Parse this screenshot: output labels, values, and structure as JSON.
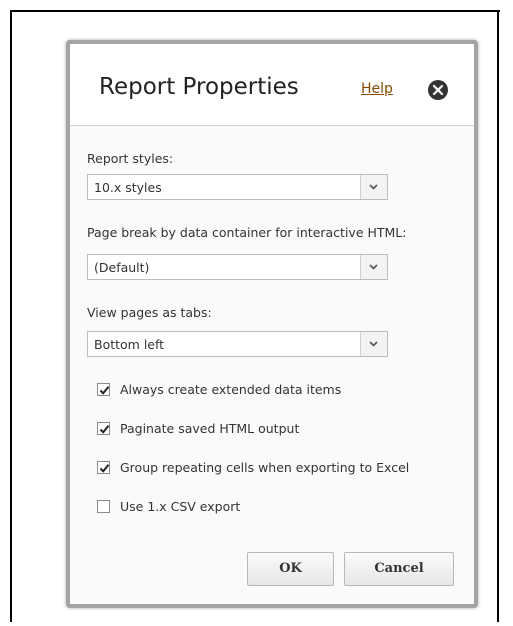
{
  "dialog": {
    "title": "Report Properties",
    "help_label": "Help",
    "close_icon": "close-icon"
  },
  "fields": {
    "report_styles": {
      "label": "Report styles:",
      "value": "10.x styles"
    },
    "page_break": {
      "label": "Page break by data container for interactive HTML:",
      "value": "(Default)"
    },
    "view_pages": {
      "label": "View pages as tabs:",
      "value": "Bottom left"
    }
  },
  "options": [
    {
      "label": "Always create extended data items",
      "checked": true
    },
    {
      "label": "Paginate saved HTML output",
      "checked": true
    },
    {
      "label": "Group repeating cells when exporting to Excel",
      "checked": true
    },
    {
      "label": "Use 1.x CSV export",
      "checked": false
    }
  ],
  "buttons": {
    "ok": "OK",
    "cancel": "Cancel"
  },
  "colors": {
    "help_link": "#8a4b00",
    "dialog_border": "#a4a4a4",
    "close_button": "#333333"
  }
}
